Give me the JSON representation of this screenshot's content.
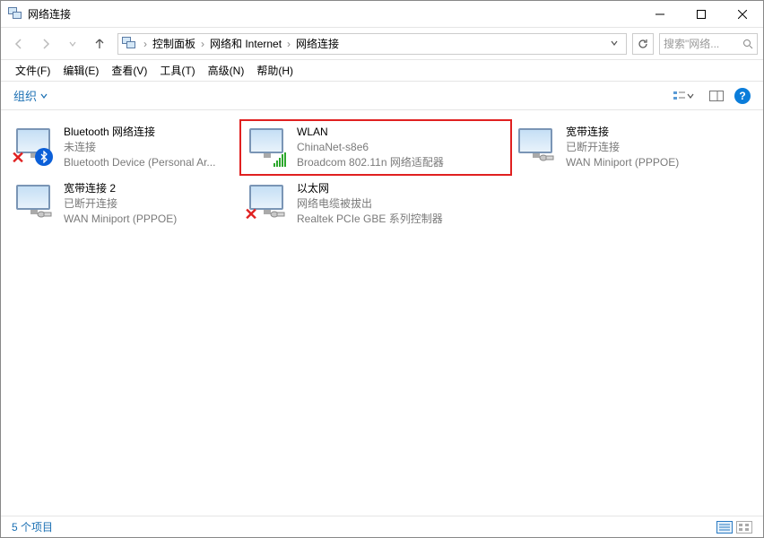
{
  "titlebar": {
    "title": "网络连接"
  },
  "breadcrumbs": {
    "a": "控制面板",
    "b": "网络和 Internet",
    "c": "网络连接"
  },
  "search": {
    "placeholder": "搜索\"网络..."
  },
  "menu": {
    "file": "文件(F)",
    "edit": "编辑(E)",
    "view": "查看(V)",
    "tools": "工具(T)",
    "advanced": "高级(N)",
    "help": "帮助(H)"
  },
  "toolbar": {
    "organize": "组织"
  },
  "connections": [
    {
      "name": "Bluetooth 网络连接",
      "status": "未连接",
      "device": "Bluetooth Device (Personal Ar...",
      "icon": "bluetooth",
      "bad": true
    },
    {
      "name": "WLAN",
      "status": "ChinaNet-s8e6",
      "device": "Broadcom 802.11n 网络适配器",
      "icon": "wifi",
      "bad": false,
      "highlighted": true
    },
    {
      "name": "宽带连接",
      "status": "已断开连接",
      "device": "WAN Miniport (PPPOE)",
      "icon": "plug",
      "bad": false
    },
    {
      "name": "宽带连接 2",
      "status": "已断开连接",
      "device": "WAN Miniport (PPPOE)",
      "icon": "plug",
      "bad": false
    },
    {
      "name": "以太网",
      "status": "网络电缆被拔出",
      "device": "Realtek PCIe GBE 系列控制器",
      "icon": "plug",
      "bad": true
    }
  ],
  "statusbar": {
    "count": "5 个项目"
  }
}
